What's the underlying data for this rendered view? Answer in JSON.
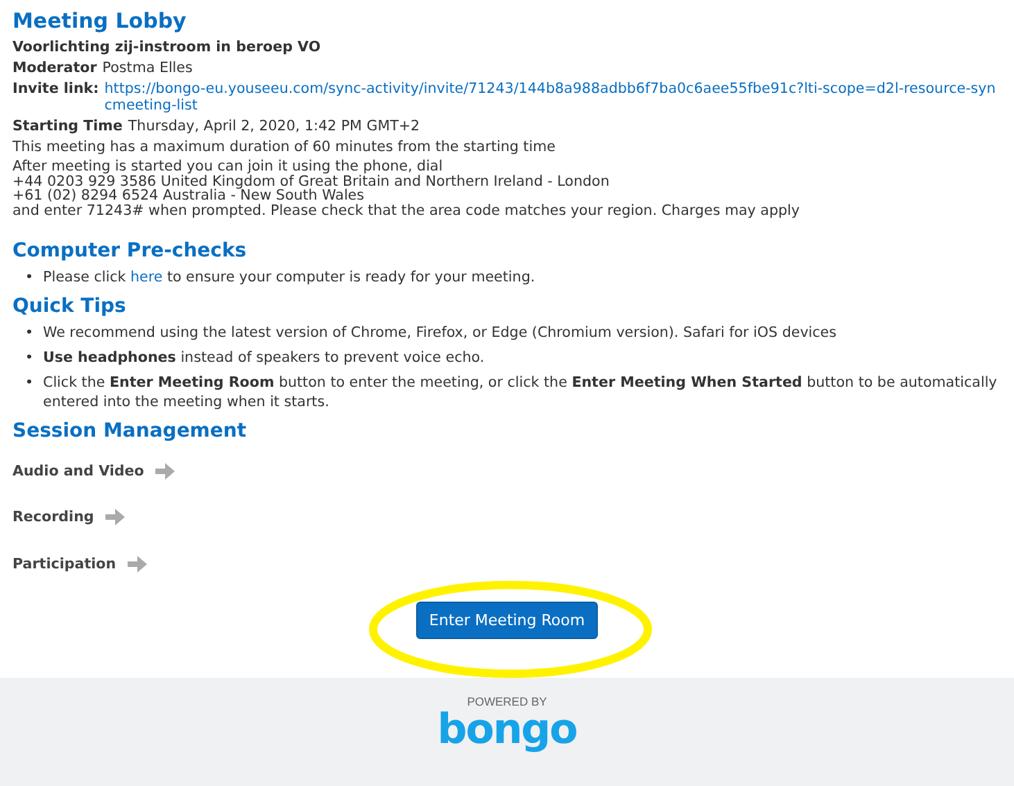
{
  "title": "Meeting Lobby",
  "meeting_name": "Voorlichting zij-instroom in beroep VO",
  "details": [
    {
      "label": "Moderator",
      "value": "Postma Elles",
      "kind": "text"
    },
    {
      "label": "Invite link:",
      "value": "https://bongo-eu.youseeu.com/sync-activity/invite/71243/144b8a988adbb6f7ba0c6aee55fbe91c?lti-scope=d2l-resource-syncmeeting-list",
      "kind": "link"
    },
    {
      "label": "Starting Time",
      "value": "Thursday, April 2, 2020, 1:42 PM GMT+2",
      "kind": "text"
    }
  ],
  "duration_note": "This meeting has a maximum duration of 60 minutes from the starting time",
  "phone_lines": [
    "After meeting is started you can join it using the phone, dial",
    "+44 0203 929 3586 United Kingdom of Great Britain and Northern Ireland - London",
    "+61 (02) 8294 6524 Australia - New South Wales",
    "and enter 71243# when prompted. Please check that the area code matches your region. Charges may apply"
  ],
  "prechecks": {
    "heading": "Computer Pre-checks",
    "bullet": "•",
    "before": "Please click ",
    "link": "here",
    "after": " to ensure your computer is ready for your meeting."
  },
  "tips": {
    "heading": "Quick Tips",
    "bullet": "•",
    "items": [
      "We recommend using the latest version of Chrome, Firefox, or Edge (Chromium version). Safari for iOS devices",
      "**Use headphones** instead of speakers to prevent voice echo.",
      "Click the **Enter Meeting Room** button to enter the meeting, or click the **Enter Meeting When Started** button to be automatically entered into the meeting when it starts."
    ]
  },
  "session": {
    "heading": "Session Management",
    "items": [
      "Audio and Video",
      "Recording",
      "Participation"
    ]
  },
  "enter_button": "Enter Meeting Room",
  "footer": {
    "powered_by": "POWERED BY",
    "logo": "bongo"
  }
}
